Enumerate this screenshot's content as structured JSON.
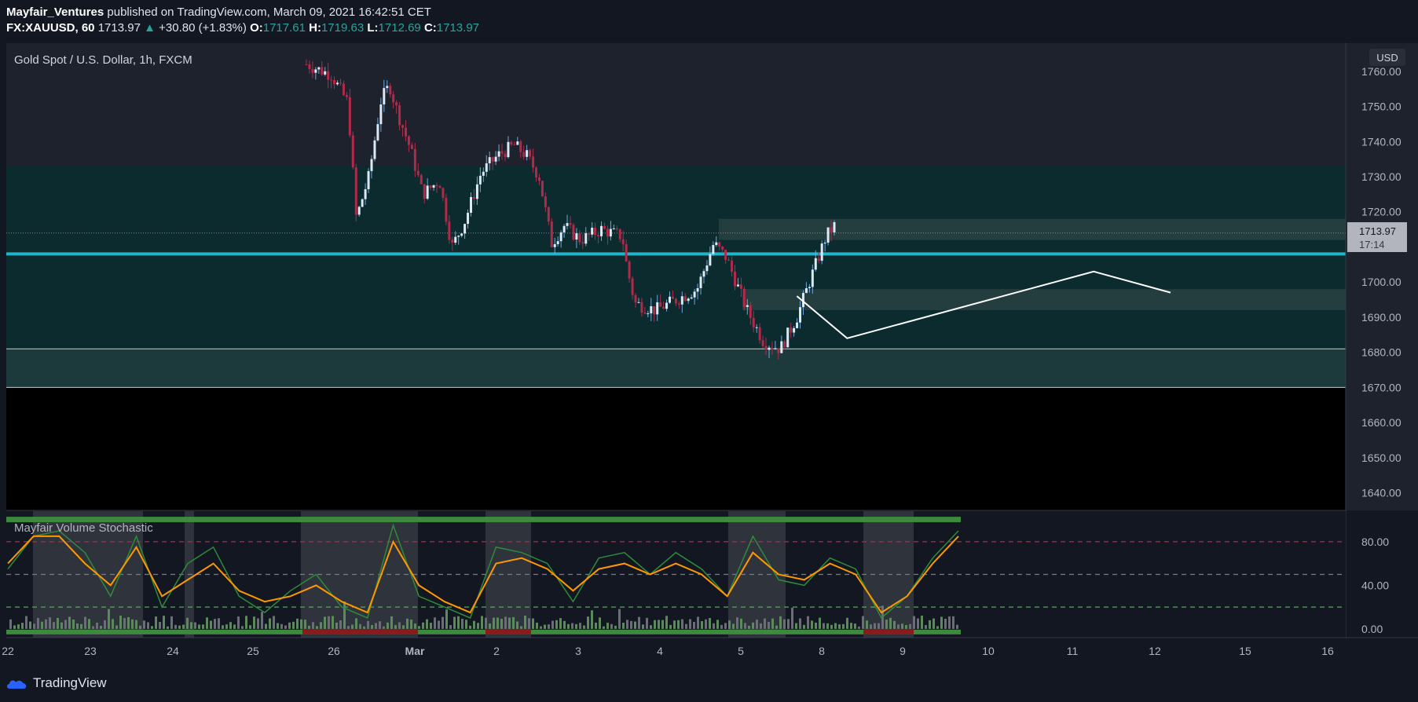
{
  "header": {
    "author": "Mayfair_Ventures",
    "published": "published on TradingView.com, March 09, 2021 16:42:51 CET",
    "symbol": "FX:XAUUSD, 60",
    "last": "1713.97",
    "change": "+30.80 (+1.83%)",
    "o_label": "O:",
    "o": "1717.61",
    "h_label": "H:",
    "h": "1719.63",
    "l_label": "L:",
    "l": "1712.69",
    "c_label": "C:",
    "c": "1713.97"
  },
  "main_pane": {
    "title": "Gold Spot / U.S. Dollar, 1h, FXCM",
    "currency": "USD",
    "price_label": "1713.97",
    "countdown": "17:14"
  },
  "indicator": {
    "title": "Mayfair Volume Stochastic"
  },
  "footer": {
    "brand": "TradingView",
    "logo_icon": "tradingview-cloud-icon"
  },
  "colors": {
    "bg": "#131722",
    "up": "#dbe9f5",
    "down": "#b22a4a",
    "zone": "#0b2b2e",
    "line": "#1fb6c9",
    "k": "#2e8b3a",
    "d": "#ff9800"
  },
  "chart_data": [
    {
      "type": "candlestick",
      "title": "Gold Spot / U.S. Dollar, 1h, FXCM",
      "y_ticks": [
        1640,
        1650,
        1660,
        1670,
        1680,
        1690,
        1700,
        1710,
        1720,
        1730,
        1740,
        1750,
        1760
      ],
      "y_tick_labels": [
        "1640.00",
        "1650.00",
        "1660.00",
        "1670.00",
        "1680.00",
        "1690.00",
        "1700.00",
        "1710.00",
        "1720.00",
        "1730.00",
        "1740.00",
        "1750.00",
        "1760.00"
      ],
      "ylim": [
        1635,
        1768
      ],
      "x_labels": [
        "22",
        "23",
        "24",
        "25",
        "26",
        "Mar",
        "2",
        "3",
        "4",
        "5",
        "8",
        "9",
        "10",
        "11",
        "12",
        "15",
        "16"
      ],
      "key_level": 1708,
      "zones": [
        {
          "from": 1681,
          "to": 1733
        },
        {
          "from": 1670,
          "to": 1681
        },
        {
          "from": 1712,
          "to": 1718
        },
        {
          "from": 1692,
          "to": 1698
        }
      ],
      "close_points": [
        {
          "x": 0.0,
          "y": 1762
        },
        {
          "x": 0.3,
          "y": 1759
        },
        {
          "x": 0.5,
          "y": 1751
        },
        {
          "x": 0.6,
          "y": 1718
        },
        {
          "x": 0.75,
          "y": 1730
        },
        {
          "x": 0.9,
          "y": 1752
        },
        {
          "x": 1.0,
          "y": 1756
        },
        {
          "x": 1.1,
          "y": 1748
        },
        {
          "x": 1.25,
          "y": 1738
        },
        {
          "x": 1.4,
          "y": 1725
        },
        {
          "x": 1.6,
          "y": 1729
        },
        {
          "x": 1.75,
          "y": 1710
        },
        {
          "x": 1.9,
          "y": 1717
        },
        {
          "x": 2.1,
          "y": 1731
        },
        {
          "x": 2.3,
          "y": 1736
        },
        {
          "x": 2.5,
          "y": 1739
        },
        {
          "x": 2.65,
          "y": 1736
        },
        {
          "x": 2.8,
          "y": 1730
        },
        {
          "x": 2.95,
          "y": 1711
        },
        {
          "x": 3.1,
          "y": 1716
        },
        {
          "x": 3.3,
          "y": 1712
        },
        {
          "x": 3.55,
          "y": 1715
        },
        {
          "x": 3.8,
          "y": 1713
        },
        {
          "x": 3.85,
          "y": 1705
        },
        {
          "x": 3.95,
          "y": 1694
        },
        {
          "x": 4.2,
          "y": 1692
        },
        {
          "x": 4.45,
          "y": 1695
        },
        {
          "x": 4.7,
          "y": 1698
        },
        {
          "x": 4.9,
          "y": 1711
        },
        {
          "x": 5.05,
          "y": 1707
        },
        {
          "x": 5.3,
          "y": 1692
        },
        {
          "x": 5.5,
          "y": 1683
        },
        {
          "x": 5.7,
          "y": 1681
        },
        {
          "x": 5.9,
          "y": 1690
        },
        {
          "x": 6.05,
          "y": 1700
        },
        {
          "x": 6.25,
          "y": 1713
        },
        {
          "x": 6.35,
          "y": 1716
        }
      ],
      "drawing_path": [
        {
          "x": 5.9,
          "y": 1696
        },
        {
          "x": 6.55,
          "y": 1684
        },
        {
          "x": 10.4,
          "y": 1703
        },
        {
          "x": 11.6,
          "y": 1697
        }
      ]
    },
    {
      "type": "line",
      "title": "Mayfair Volume Stochastic",
      "y_ticks": [
        0,
        40,
        80
      ],
      "y_tick_labels": [
        "0.00",
        "40.00",
        "80.00"
      ],
      "levels": [
        20,
        50,
        80
      ],
      "ylim": [
        -8,
        108
      ],
      "series": [
        {
          "values_k": [
            55,
            85,
            90,
            70,
            30,
            85,
            20,
            60,
            75,
            30,
            15,
            35,
            50,
            20,
            10,
            95,
            30,
            20,
            10,
            75,
            70,
            60,
            25,
            65,
            70,
            50,
            70,
            55,
            30,
            85,
            45,
            40,
            65,
            55,
            10,
            30,
            65,
            90
          ]
        },
        {
          "values_d": [
            60,
            85,
            85,
            60,
            40,
            75,
            30,
            45,
            60,
            35,
            25,
            30,
            40,
            25,
            15,
            80,
            40,
            25,
            15,
            60,
            65,
            55,
            35,
            55,
            60,
            50,
            60,
            50,
            30,
            70,
            50,
            45,
            60,
            50,
            15,
            30,
            60,
            85
          ]
        }
      ]
    }
  ]
}
